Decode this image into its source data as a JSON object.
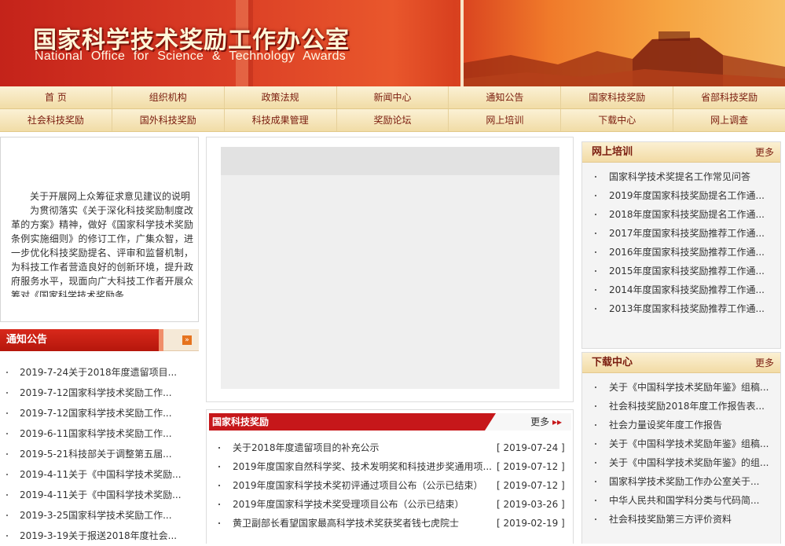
{
  "header": {
    "title_cn": "国家科学技术奖励工作办公室",
    "title_en": "National Office for Science & Technology Awards"
  },
  "nav": {
    "row1": [
      "首 页",
      "组织机构",
      "政策法规",
      "新闻中心",
      "通知公告",
      "国家科技奖励",
      "省部科技奖励"
    ],
    "row2": [
      "社会科技奖励",
      "国外科技奖励",
      "科技成果管理",
      "奖励论坛",
      "网上培训",
      "下载中心",
      "网上调查"
    ]
  },
  "intro": {
    "paragraph1": "关于开展网上众筹征求意见建议的说明",
    "paragraph2": "为贯彻落实《关于深化科技奖励制度改革的方案》精神，做好《国家科学技术奖励条例实施细则》的修订工作，广集众智，进一步优化科技奖励提名、评审和监督机制，为科技工作者营造良好的创新环境，提升政府服务水平，现面向广大科技工作者开展众筹对《国家科学技术奖励条"
  },
  "notice": {
    "title": "通知公告",
    "more_icon": "»",
    "items": [
      "2019-7-24关于2018年度遗留项目...",
      "2019-7-12国家科学技术奖励工作...",
      "2019-7-12国家科学技术奖励工作...",
      "2019-6-11国家科学技术奖励工作...",
      "2019-5-21科技部关于调整第五届...",
      "2019-4-11关于《中国科学技术奖励...",
      "2019-4-11关于《中国科学技术奖励...",
      "2019-3-25国家科学技术奖励工作...",
      "2019-3-19关于报送2018年度社会..."
    ]
  },
  "award": {
    "title": "国家科技奖励",
    "more": "更多",
    "more_icon": "▸▸",
    "items": [
      {
        "title": "关于2018年度遗留项目的补充公示",
        "date": "[ 2019-07-24 ]"
      },
      {
        "title": "2019年度国家自然科学奖、技术发明奖和科技进步奖通用项...",
        "date": "[ 2019-07-12 ]"
      },
      {
        "title": "2019年度国家科学技术奖初评通过项目公布（公示已结束）",
        "date": "[ 2019-07-12 ]"
      },
      {
        "title": "2019年度国家科学技术奖受理项目公布（公示已结束）",
        "date": "[ 2019-03-26 ]"
      },
      {
        "title": "黄卫副部长看望国家最高科学技术奖获奖者钱七虎院士",
        "date": "[ 2019-02-19 ]"
      }
    ]
  },
  "online_training": {
    "title": "网上培训",
    "more": "更多",
    "items": [
      "国家科学技术奖提名工作常见问答",
      "2019年度国家科技奖励提名工作通...",
      "2018年度国家科技奖励提名工作通...",
      "2017年度国家科技奖励推荐工作通...",
      "2016年度国家科技奖励推荐工作通...",
      "2015年度国家科技奖励推荐工作通...",
      "2014年度国家科技奖励推荐工作通...",
      "2013年度国家科技奖励推荐工作通..."
    ]
  },
  "download": {
    "title": "下载中心",
    "more": "更多",
    "items": [
      "关于《中国科学技术奖励年鉴》组稿...",
      "社会科技奖励2018年度工作报告表...",
      "社会力量设奖年度工作报告",
      "关于《中国科学技术奖励年鉴》组稿...",
      "关于《中国科学技术奖励年鉴》的组...",
      "国家科学技术奖励工作办公室关于...",
      "中华人民共和国学科分类与代码简...",
      "社会科技奖励第三方评价资料"
    ]
  }
}
